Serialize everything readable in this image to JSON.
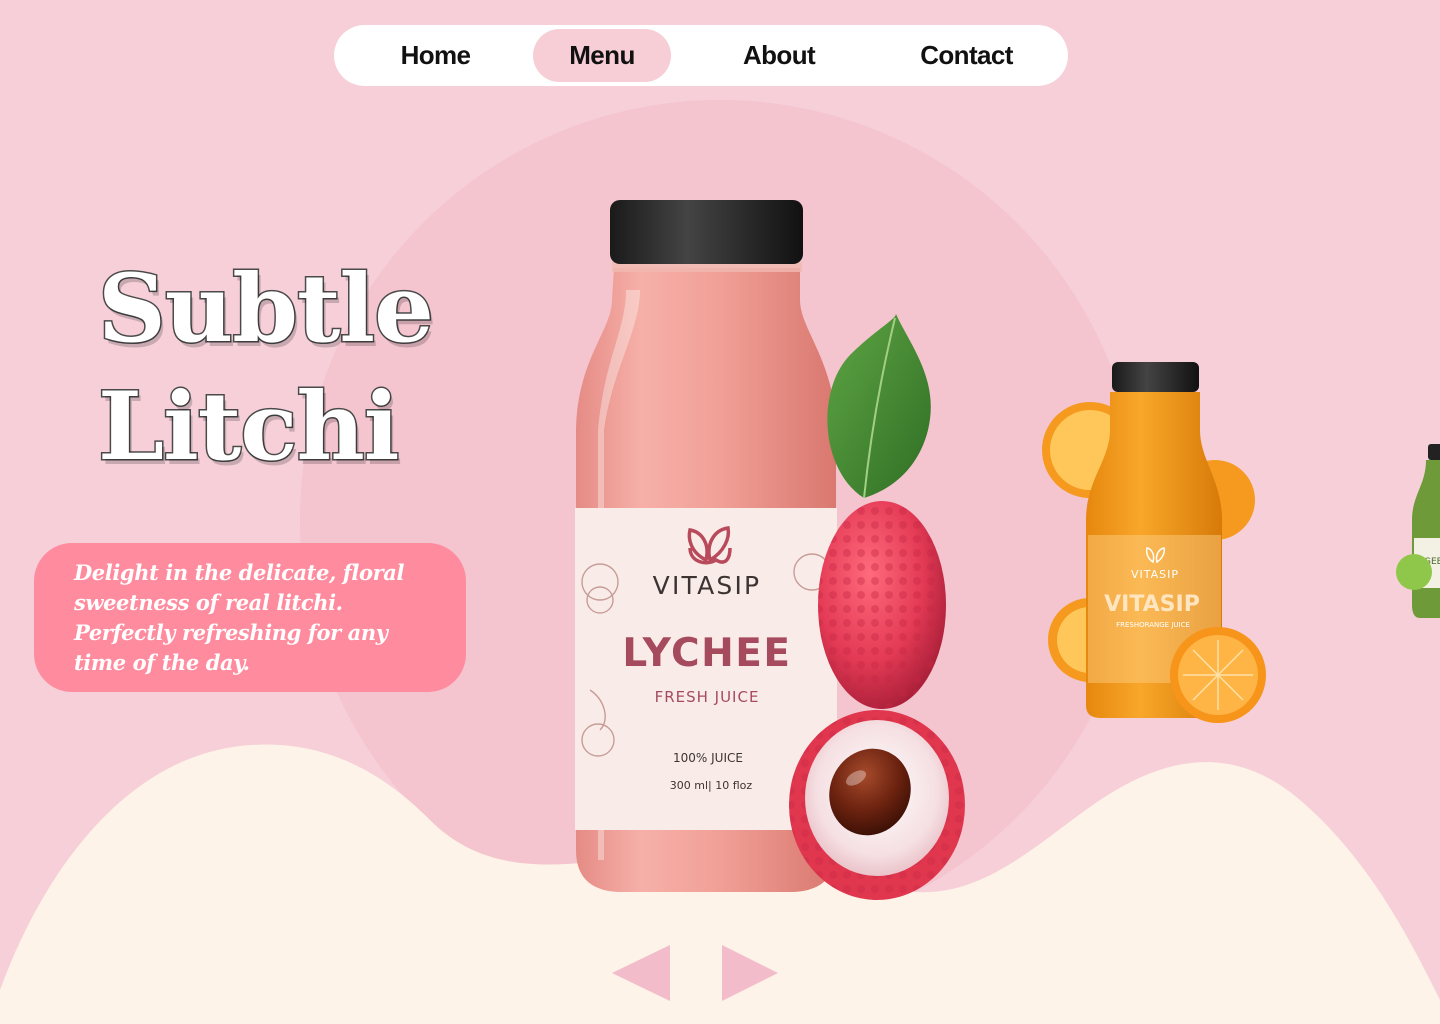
{
  "nav": {
    "items": [
      {
        "label": "Home",
        "active": false
      },
      {
        "label": "Menu",
        "active": true
      },
      {
        "label": "About",
        "active": false
      },
      {
        "label": "Contact",
        "active": false
      }
    ]
  },
  "hero": {
    "title_line1": "Subtle",
    "title_line2": "Litchi",
    "description": "Delight in the delicate, floral sweetness of real litchi. Perfectly refreshing for any time of the day."
  },
  "main_product": {
    "brand": "VITASIP",
    "flavor": "LYCHEE",
    "subtitle": "FRESH JUICE",
    "percent": "100% JUICE",
    "volume": "300 ml| 10 floz"
  },
  "secondary_product": {
    "brand_small": "VITASIP",
    "brand_large": "VITASIP",
    "subtitle": "FRESHORANGE JUICE"
  },
  "carousel": {
    "prev_icon": "triangle-left-icon",
    "next_icon": "triangle-right-icon"
  },
  "colors": {
    "background": "#f6cfd8",
    "cream": "#fef3e8",
    "accent_pink": "#ff8c9e",
    "nav_active": "#f7cdd6"
  }
}
